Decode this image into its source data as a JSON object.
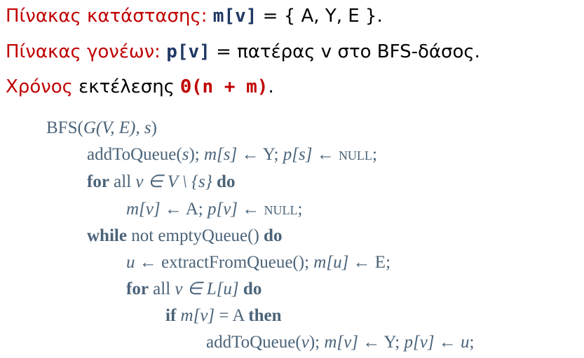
{
  "bullets": [
    {
      "label": "Πίνακας κατάστασης:",
      "code": "m[v]",
      "rest": " = { A, Y, E }."
    },
    {
      "label": "Πίνακας γονέων:",
      "code": "p[v]",
      "rest": " = πατέρας v στο BFS-δάσος."
    },
    {
      "label_red": "Χρόνος",
      "label_black": " εκτέλεσης ",
      "complexity": "Θ(n + m)",
      "end": "."
    }
  ],
  "algorithm": {
    "l1_name": "BFS(",
    "l1_args": "G(V, E), s",
    "l1_close": ")",
    "l2_a": "addToQueue(",
    "l2_s": "s",
    "l2_b": "); ",
    "l2_m": "m[s]",
    "l2_c": " ← Y; ",
    "l2_p": "p[s]",
    "l2_d": " ← ",
    "l2_null": "null",
    "l2_e": ";",
    "l3_for": "for",
    "l3_all": " all ",
    "l3_set": "v ∈ V \\ {s}",
    "l3_do": " do",
    "l4_m": "m[v]",
    "l4_a": " ← A; ",
    "l4_p": "p[v]",
    "l4_b": " ← ",
    "l4_null": "null",
    "l4_c": ";",
    "l5_while": "while",
    "l5_mid": " not emptyQueue() ",
    "l5_do": "do",
    "l6_u": "u",
    "l6_a": " ← extractFromQueue(); ",
    "l6_m": "m[u]",
    "l6_b": " ← E;",
    "l7_for": "for",
    "l7_all": " all ",
    "l7_set": "v ∈ L[u]",
    "l7_do": " do",
    "l8_if": "if",
    "l8_cond": " m[v]",
    "l8_eq": " = A ",
    "l8_then": "then",
    "l9_a": "addToQueue(",
    "l9_v": "v",
    "l9_b": "); ",
    "l9_m": "m[v]",
    "l9_c": " ← Y; ",
    "l9_p": "p[v]",
    "l9_d": " ← ",
    "l9_u": "u",
    "l9_e": ";"
  }
}
